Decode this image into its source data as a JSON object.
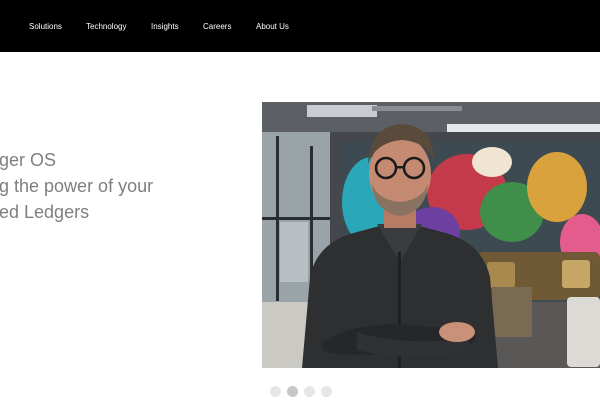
{
  "nav": {
    "items": [
      {
        "label": "Solutions"
      },
      {
        "label": "Technology"
      },
      {
        "label": "Insights"
      },
      {
        "label": "Careers"
      },
      {
        "label": "About Us"
      }
    ]
  },
  "hero": {
    "lines": [
      "ger OS",
      "g the power of your",
      "ed Ledgers"
    ]
  },
  "carousel": {
    "slide_count": 4,
    "active_index": 1
  },
  "colors": {
    "nav_bg": "#000000",
    "hero_text": "#7f7f7f",
    "dot_inactive": "#e6e6e6",
    "dot_active": "#c6c6c6"
  }
}
